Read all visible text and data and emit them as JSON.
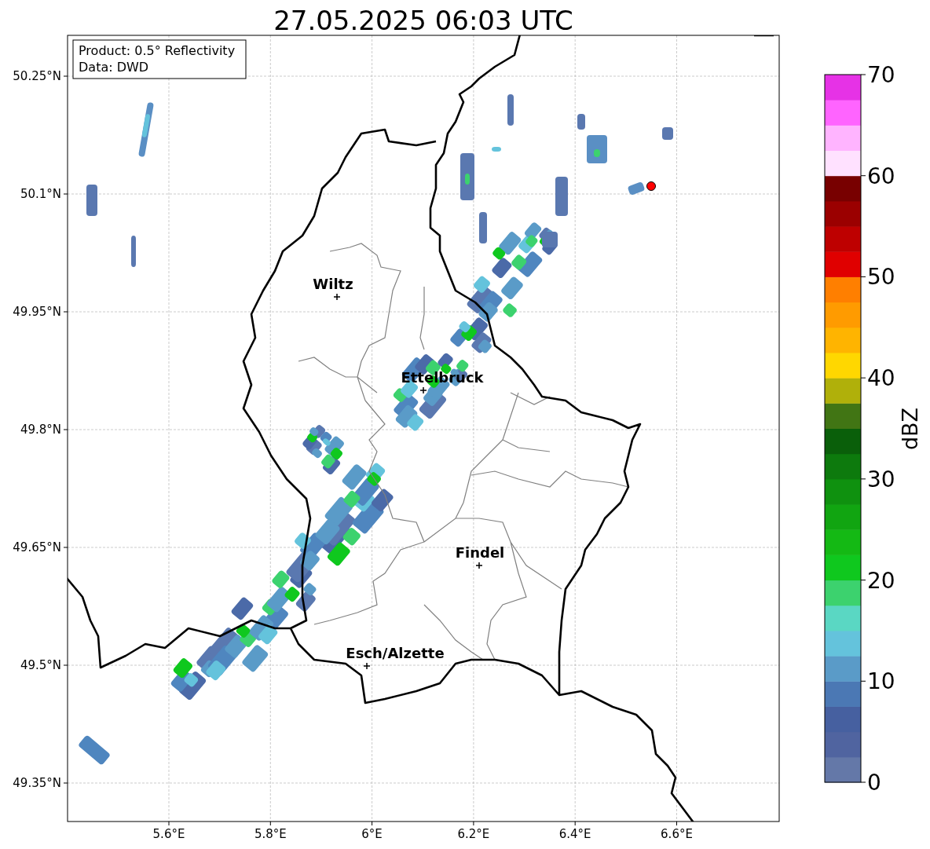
{
  "title": "27.05.2025 06:03 UTC",
  "legend": [
    "Product: 0.5° Reflectivity",
    "Data: DWD"
  ],
  "map": {
    "yticks": [
      "50.25°N",
      "50.1°N",
      "49.95°N",
      "49.8°N",
      "49.65°N",
      "49.5°N",
      "49.35°N"
    ],
    "xticks": [
      "5.6°E",
      "5.8°E",
      "6°E",
      "6.2°E",
      "6.4°E",
      "6.6°E"
    ],
    "cities": [
      {
        "name": "Wiltz"
      },
      {
        "name": "Ettelbruck"
      },
      {
        "name": "Findel"
      },
      {
        "name": "Esch/Alzette"
      }
    ]
  },
  "colorbar": {
    "label": "dBZ",
    "ticks": [
      "70",
      "60",
      "50",
      "40",
      "30",
      "20",
      "10",
      "0"
    ],
    "colors": [
      {
        "color": "#6478a8"
      },
      {
        "color": "#5064a0"
      },
      {
        "color": "#4660a0"
      },
      {
        "color": "#4b78b4"
      },
      {
        "color": "#5a9bc8"
      },
      {
        "color": "#64c3dc"
      },
      {
        "color": "#5ad7c3"
      },
      {
        "color": "#3cd26e"
      },
      {
        "color": "#0fc81e"
      },
      {
        "color": "#14b914"
      },
      {
        "color": "#11a511"
      },
      {
        "color": "#0f910f"
      },
      {
        "color": "#0d7a0d"
      },
      {
        "color": "#0a5f0a"
      },
      {
        "color": "#417514"
      },
      {
        "color": "#b0b00a"
      },
      {
        "color": "#ffd700"
      },
      {
        "color": "#ffb400"
      },
      {
        "color": "#ff9b00"
      },
      {
        "color": "#ff7f00"
      },
      {
        "color": "#e00000"
      },
      {
        "color": "#be0000"
      },
      {
        "color": "#9b0000"
      },
      {
        "color": "#780000"
      },
      {
        "color": "#ffe1ff"
      },
      {
        "color": "#ffb4ff"
      },
      {
        "color": "#ff64ff"
      },
      {
        "color": "#e632e6"
      }
    ]
  }
}
